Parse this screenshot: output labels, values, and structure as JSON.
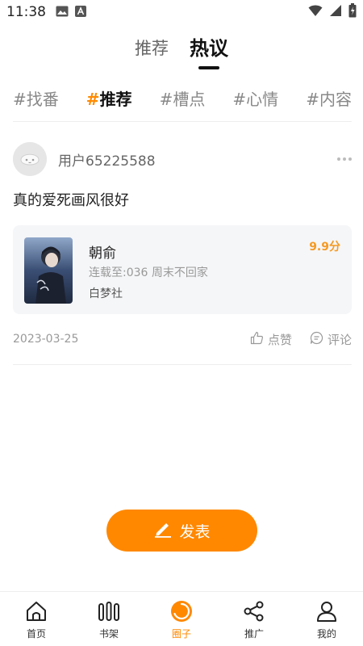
{
  "status_bar": {
    "time": "11:38"
  },
  "top_tabs": [
    {
      "label": "推荐",
      "active": false
    },
    {
      "label": "热议",
      "active": true
    }
  ],
  "tags": [
    {
      "hash": "#",
      "label": "找番",
      "active": false
    },
    {
      "hash": "#",
      "label": "推荐",
      "active": true
    },
    {
      "hash": "#",
      "label": "槽点",
      "active": false
    },
    {
      "hash": "#",
      "label": "心情",
      "active": false
    },
    {
      "hash": "#",
      "label": "内容",
      "active": false
    }
  ],
  "post": {
    "username": "用户65225588",
    "text": "真的爱死画风很好",
    "book": {
      "title": "朝俞",
      "update": "连载至:036 周末不回家",
      "publisher": "白梦社",
      "score": "9.9分"
    },
    "date": "2023-03-25",
    "like_label": "点赞",
    "comment_label": "评论"
  },
  "publish_button": {
    "label": "发表"
  },
  "bottom_nav": [
    {
      "label": "首页",
      "icon": "home-icon",
      "active": false
    },
    {
      "label": "书架",
      "icon": "bookshelf-icon",
      "active": false
    },
    {
      "label": "圈子",
      "icon": "circle-icon",
      "active": true
    },
    {
      "label": "推广",
      "icon": "share-icon",
      "active": false
    },
    {
      "label": "我的",
      "icon": "user-icon",
      "active": false
    }
  ],
  "colors": {
    "accent": "#ff8800",
    "score": "#f59a23",
    "card_bg": "#f5f6f8"
  }
}
